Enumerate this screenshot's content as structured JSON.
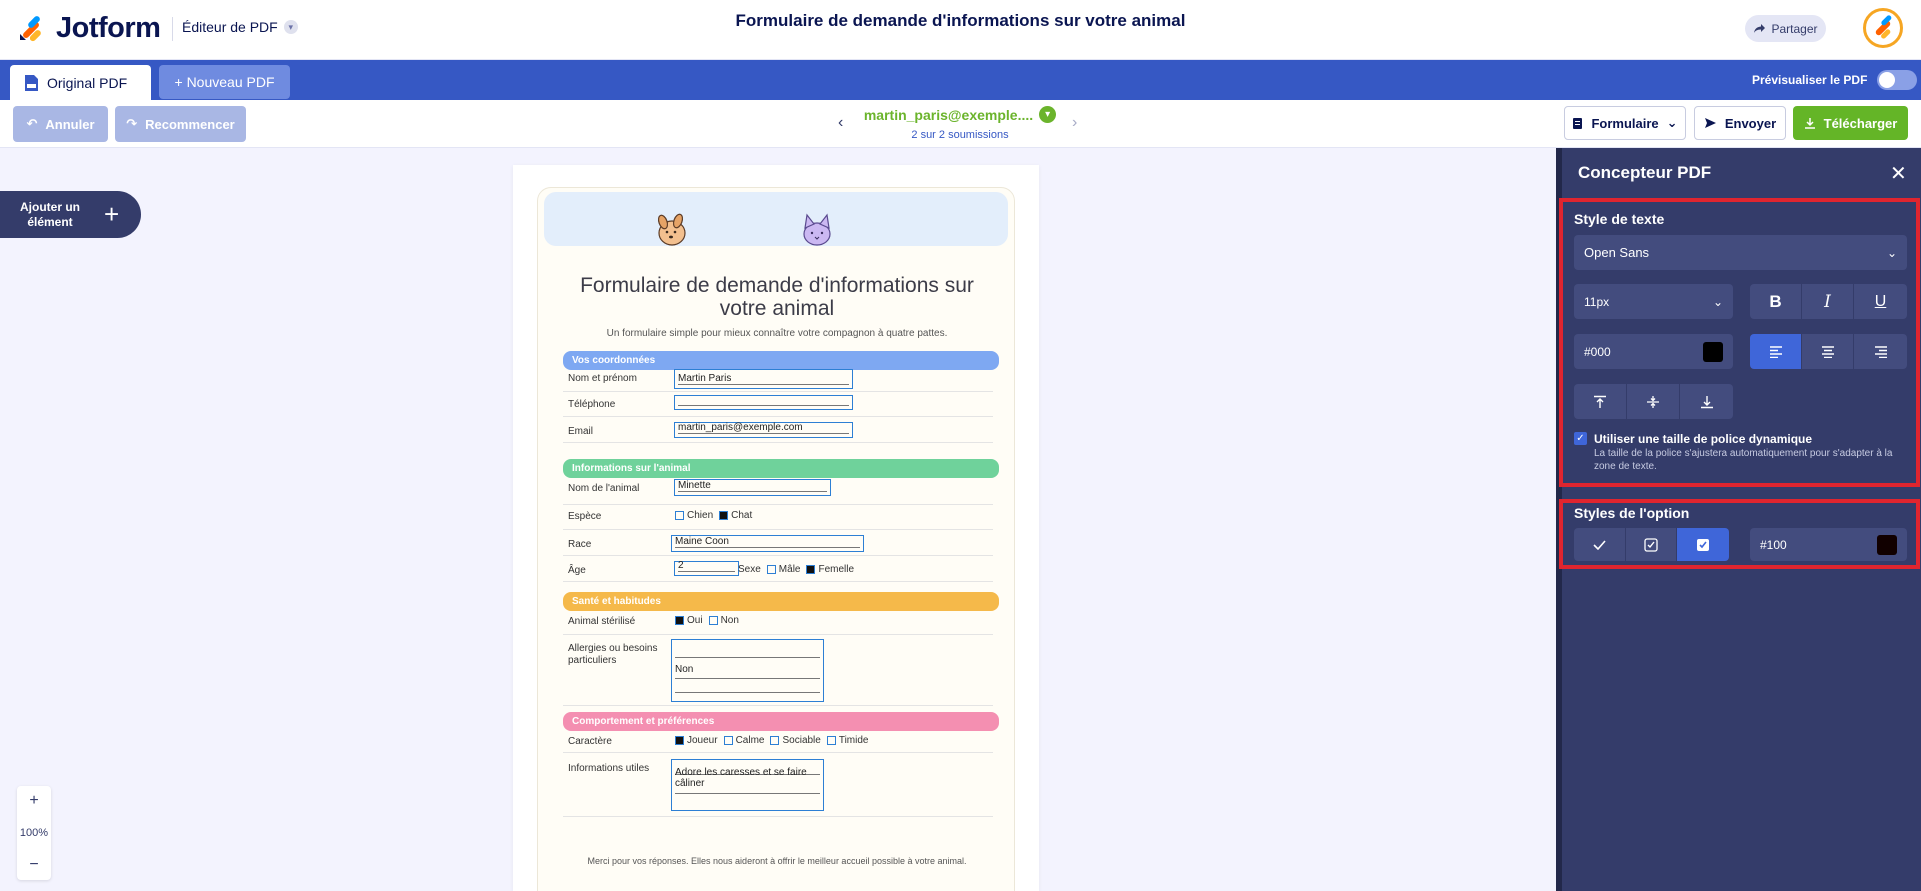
{
  "header": {
    "brand": "Jotform",
    "app_name": "Éditeur de PDF",
    "doc_title": "Formulaire de demande d'informations sur votre animal",
    "share_label": "Partager"
  },
  "tabs": {
    "original": "Original PDF",
    "new": "+ Nouveau PDF",
    "preview_label": "Prévisualiser le PDF"
  },
  "toolbar": {
    "undo": "Annuler",
    "redo": "Recommencer",
    "submission_email": "martin_paris@exemple....",
    "submission_count": "2 sur 2 soumissions",
    "form_dropdown": "Formulaire",
    "send": "Envoyer",
    "download": "Télécharger"
  },
  "canvas": {
    "add_element": "Ajouter un élément",
    "zoom_in": "+",
    "zoom_level": "100%",
    "zoom_out": "−"
  },
  "form": {
    "title": "Formulaire de demande d'informations sur votre animal",
    "subtitle": "Un formulaire simple pour mieux connaître votre compagnon à quatre pattes.",
    "sections": {
      "coords": "Vos coordonnées",
      "animal": "Informations sur l'animal",
      "health": "Santé et habitudes",
      "behavior": "Comportement et préférences"
    },
    "labels": {
      "name": "Nom et prénom",
      "phone": "Téléphone",
      "email": "Email",
      "pet_name": "Nom de l'animal",
      "species": "Espèce",
      "breed": "Race",
      "age": "Âge",
      "sex": "Sexe",
      "sterilized": "Animal stérilisé",
      "allergies": "Allergies ou besoins particuliers",
      "character": "Caractère",
      "useful": "Informations utiles"
    },
    "values": {
      "name": "Martin Paris",
      "phone": "",
      "email": "martin_paris@exemple.com",
      "pet_name": "Minette",
      "breed": "Maine Coon",
      "age": "2",
      "allergies": "Non",
      "useful": "Adore les caresses et se faire câliner"
    },
    "options": {
      "dog": "Chien",
      "cat": "Chat",
      "male": "Mâle",
      "female": "Femelle",
      "yes": "Oui",
      "no": "Non",
      "playful": "Joueur",
      "calm": "Calme",
      "sociable": "Sociable",
      "shy": "Timide"
    },
    "footnote": "Merci pour vos réponses. Elles nous aideront à offrir le meilleur accueil possible à votre animal."
  },
  "panel": {
    "title": "Concepteur PDF",
    "text_style_title": "Style de texte",
    "font_family": "Open Sans",
    "font_size": "11px",
    "text_color": "#000",
    "dynamic_title": "Utiliser une taille de police dynamique",
    "dynamic_desc": "La taille de la police s'ajustera automatiquement pour s'adapter à la zone de texte.",
    "option_styles_title": "Styles de l'option",
    "option_color": "#100"
  },
  "colors": {
    "brand_blue": "#3658c4",
    "panel_bg": "#343c6a",
    "green": "#64b527",
    "section_blue": "#7ea8f2",
    "section_green": "#6fd29b",
    "section_orange": "#f5b94a",
    "section_pink": "#f48fb1",
    "highlight_red": "#e0252f"
  }
}
